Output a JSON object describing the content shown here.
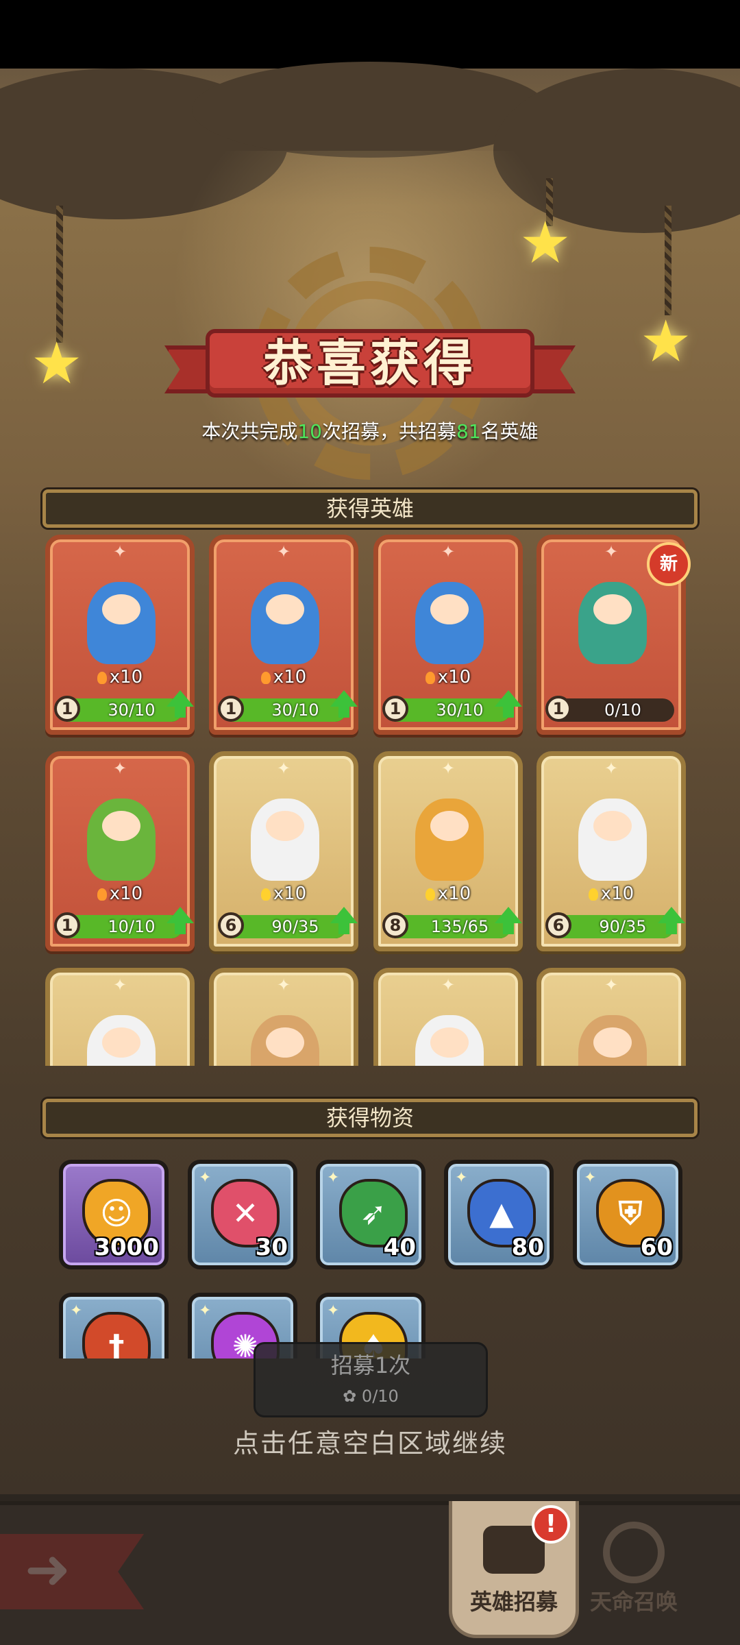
{
  "banner": {
    "title": "恭喜获得"
  },
  "summary": {
    "prefix": "本次共完成",
    "draws": "10",
    "mid": "次招募，共招募",
    "heroes": "81",
    "suffix": "名英雄"
  },
  "sections": {
    "heroes": "获得英雄",
    "items": "获得物资"
  },
  "hero_cards": [
    {
      "frame": "orange",
      "icon": "blue-caped-swordsman-icon",
      "count": "x10",
      "level": "1",
      "progress": "30/10",
      "fill": 1.0,
      "can_upgrade": true,
      "is_new": false
    },
    {
      "frame": "orange",
      "icon": "blue-caped-swordsman-icon",
      "count": "x10",
      "level": "1",
      "progress": "30/10",
      "fill": 1.0,
      "can_upgrade": true,
      "is_new": false
    },
    {
      "frame": "orange",
      "icon": "blue-caped-swordsman-icon",
      "count": "x10",
      "level": "1",
      "progress": "30/10",
      "fill": 1.0,
      "can_upgrade": true,
      "is_new": false
    },
    {
      "frame": "orange",
      "icon": "witch-with-scroll-icon",
      "count": "",
      "level": "1",
      "progress": "0/10",
      "fill": 0.0,
      "can_upgrade": false,
      "is_new": true
    },
    {
      "frame": "orange",
      "icon": "leafy-tree-warrior-icon",
      "count": "x10",
      "level": "1",
      "progress": "10/10",
      "fill": 1.0,
      "can_upgrade": true,
      "is_new": false
    },
    {
      "frame": "gold",
      "icon": "cowboy-dog-gunner-icon",
      "count": "x10",
      "level": "6",
      "progress": "90/35",
      "fill": 1.0,
      "can_upgrade": true,
      "is_new": false
    },
    {
      "frame": "gold",
      "icon": "spiky-armadillo-icon",
      "count": "x10",
      "level": "8",
      "progress": "135/65",
      "fill": 1.0,
      "can_upgrade": true,
      "is_new": false
    },
    {
      "frame": "gold",
      "icon": "cowboy-dog-gunner-icon",
      "count": "x10",
      "level": "6",
      "progress": "90/35",
      "fill": 1.0,
      "can_upgrade": true,
      "is_new": false
    },
    {
      "frame": "gold",
      "icon": "cowboy-dog-gunner-icon",
      "count": "",
      "level": "",
      "progress": "",
      "fill": 0.0,
      "can_upgrade": false,
      "is_new": false
    },
    {
      "frame": "gold",
      "icon": "fox-adventurer-icon",
      "count": "",
      "level": "",
      "progress": "",
      "fill": 0.0,
      "can_upgrade": false,
      "is_new": false
    },
    {
      "frame": "gold",
      "icon": "cowboy-dog-gunner-icon",
      "count": "",
      "level": "",
      "progress": "",
      "fill": 0.0,
      "can_upgrade": false,
      "is_new": false
    },
    {
      "frame": "gold",
      "icon": "fox-adventurer-icon",
      "count": "",
      "level": "",
      "progress": "",
      "fill": 0.0,
      "can_upgrade": false,
      "is_new": false
    }
  ],
  "new_badge": "新",
  "items": [
    {
      "frame": "purple",
      "icon": "gold-coin-face-icon",
      "glyph": "☺",
      "color": "#f0a626",
      "qty": "3000"
    },
    {
      "frame": "blue",
      "icon": "red-cross-gem-icon",
      "glyph": "✕",
      "color": "#e0506a",
      "qty": "30"
    },
    {
      "frame": "blue",
      "icon": "green-bow-gem-icon",
      "glyph": "➶",
      "color": "#3aa048",
      "qty": "40"
    },
    {
      "frame": "blue",
      "icon": "blue-wizard-gem-icon",
      "glyph": "▲",
      "color": "#3c6fd0",
      "qty": "80"
    },
    {
      "frame": "blue",
      "icon": "orange-shield-gem-icon",
      "glyph": "⛨",
      "color": "#e2921e",
      "qty": "60"
    },
    {
      "frame": "blue",
      "icon": "red-sword-gem-icon",
      "glyph": "†",
      "color": "#d24a2a",
      "qty": ""
    },
    {
      "frame": "blue",
      "icon": "purple-swirl-gem-icon",
      "glyph": "✺",
      "color": "#b045d6",
      "qty": ""
    },
    {
      "frame": "blue",
      "icon": "gold-spade-coin-icon",
      "glyph": "♠",
      "color": "#f2b81e",
      "qty": ""
    }
  ],
  "recruit_button": {
    "label": "招募1次",
    "cost": "0/10"
  },
  "continue_hint": "点击任意空白区域继续",
  "bottom_nav": {
    "back_icon": "back-arrow-icon",
    "tabs": [
      {
        "label": "英雄招募",
        "icon": "train-icon",
        "active": true
      },
      {
        "label": "天命召唤",
        "icon": "gear-icon",
        "active": false
      }
    ],
    "alert": "!"
  },
  "colors": {
    "highlight_number": "#4ee65c",
    "progress_fill": "#58b828"
  }
}
